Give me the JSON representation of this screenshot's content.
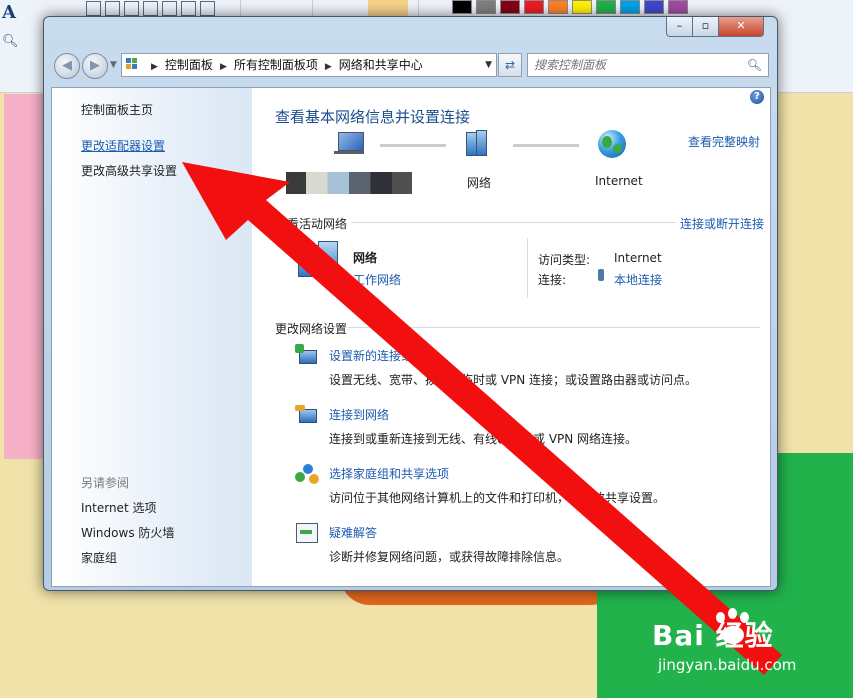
{
  "address_bar": {
    "crumbs": [
      "控制面板",
      "所有控制面板项",
      "网络和共享中心"
    ]
  },
  "search": {
    "placeholder": "搜索控制面板"
  },
  "sidebar": {
    "home": "控制面板主页",
    "adapter_settings": "更改适配器设置",
    "advanced_sharing": "更改高级共享设置",
    "see_also_title": "另请参阅",
    "see_also": [
      "Internet 选项",
      "Windows 防火墙",
      "家庭组"
    ]
  },
  "main": {
    "title": "查看基本网络信息并设置连接",
    "full_map_link": "查看完整映射",
    "map": {
      "network_label": "网络",
      "internet_label": "Internet"
    },
    "active_networks": {
      "section_title": "查看活动网络",
      "connect_link": "连接或断开连接",
      "network_name": "网络",
      "network_type": "工作网络",
      "access_type_label": "访问类型:",
      "access_type_value": "Internet",
      "connection_label": "连接:",
      "connection_value": "本地连接"
    },
    "change_settings": {
      "section_title": "更改网络设置",
      "tasks": [
        {
          "link": "设置新的连接或网络",
          "desc": "设置无线、宽带、拨号、临时或 VPN 连接；或设置路由器或访问点。"
        },
        {
          "link": "连接到网络",
          "desc": "连接到或重新连接到无线、有线、拨号或 VPN 网络连接。"
        },
        {
          "link": "选择家庭组和共享选项",
          "desc": "访问位于其他网络计算机上的文件和打印机，或更改共享设置。"
        },
        {
          "link": "疑难解答",
          "desc": "诊断并修复网络问题，或获得故障排除信息。"
        }
      ]
    }
  },
  "watermark": {
    "logo": "Bai 经验",
    "jingyan": "经验",
    "url": "jingyan.baidu.com"
  },
  "colors": {
    "link": "#1c5bb0",
    "title": "#1c4d8f",
    "arrow": "#f20f0f"
  }
}
